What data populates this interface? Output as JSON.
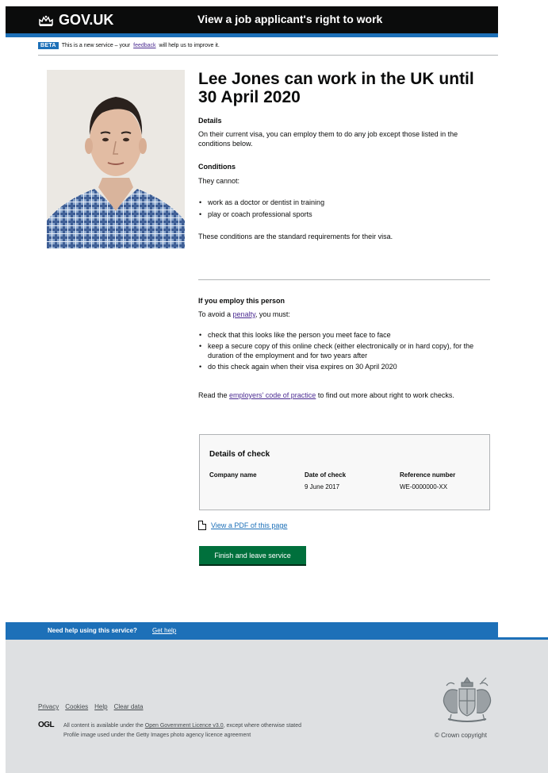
{
  "header": {
    "logo_text": "GOV.UK",
    "service_name": "View a job applicant's right to work"
  },
  "beta_banner": {
    "tag": "BETA",
    "text_before": "This is a new service – your",
    "link": "feedback",
    "text_after": "will help us to improve it."
  },
  "main": {
    "title": "Lee Jones can work in the UK until 30 April 2020",
    "details_heading": "Details",
    "details_text": "On their current visa, you can employ them to do any job except those listed in the conditions below.",
    "conditions_heading": "Conditions",
    "conditions_intro": "They cannot:",
    "conditions": [
      "work as a doctor or dentist in training",
      "play or coach professional sports"
    ],
    "conditions_note": "These conditions are the standard requirements for their visa.",
    "employ_heading": "If you employ this person",
    "employ_intro_before": "To avoid a",
    "employ_intro_link": "penalty",
    "employ_intro_after": ", you must:",
    "employ_steps": [
      "check that this looks like the person you meet face to face",
      "keep a secure copy of this online check (either electronically or in hard copy), for the duration of the employment and for two years after",
      "do this check again when their visa expires on 30 April 2020"
    ],
    "read_before": "Read the",
    "read_link": "employers' code of practice",
    "read_after": "to find out more about right to work checks."
  },
  "check_panel": {
    "title": "Details of check",
    "company_label": "Company name",
    "company_value": "",
    "date_label": "Date of check",
    "date_value": "9 June 2017",
    "ref_label": "Reference number",
    "ref_value": "WE-0000000-XX"
  },
  "pdf_link": "View a PDF of this page",
  "finish_button": "Finish and leave service",
  "help_bar": {
    "text": "Need help using this service?",
    "link": "Get help"
  },
  "footer": {
    "links": [
      "Privacy",
      "Cookies",
      "Help",
      "Clear data"
    ],
    "ogl": "OGL",
    "licence_before": "All content is available under the",
    "licence_link": "Open Government Licence v3.0",
    "licence_after": ", except where otherwise stated",
    "image_credit": "Profile image used under the Getty Images photo agency licence agreement",
    "copyright": "© Crown copyright"
  },
  "colors": {
    "header": "#0b0c0c",
    "brand_blue": "#1d70b8",
    "button_green": "#00703c",
    "footer_bg": "#dee0e2",
    "visited_link": "#4c2c92"
  }
}
